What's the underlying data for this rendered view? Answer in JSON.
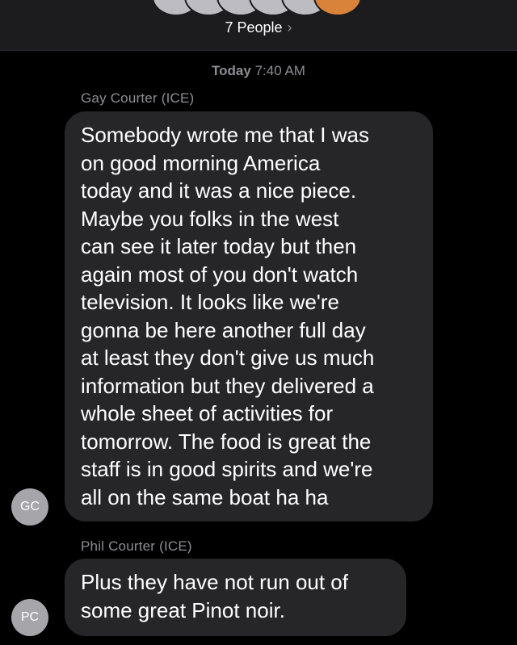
{
  "header": {
    "people_label": "7 People",
    "chevron": "›"
  },
  "timestamp": {
    "day": "Today",
    "time": "7:40 AM"
  },
  "messages": [
    {
      "sender": "Gay Courter (ICE)",
      "initials": "GC",
      "lines": [
        "Somebody wrote me that I was",
        "on good morning America",
        "today and it was a nice piece.",
        "Maybe you folks in the west",
        "can see it later today but then",
        "again most of you don't watch",
        "television. It looks like we're",
        "gonna be here another full day",
        "at least they don't give us much",
        "information but they delivered a",
        "whole sheet of activities for",
        "tomorrow. The food is great the",
        "staff is in good spirits and we're",
        "all on the same boat ha ha"
      ]
    },
    {
      "sender": "Phil Courter (ICE)",
      "initials": "PC",
      "lines": [
        "Plus they have not run out of",
        "some great Pinot noir."
      ]
    }
  ],
  "colors": {
    "background": "#000000",
    "header": "#1c1c1e",
    "bubble": "#262629",
    "secondary_text": "#8e8e93",
    "avatar": "#a5a5aa"
  }
}
